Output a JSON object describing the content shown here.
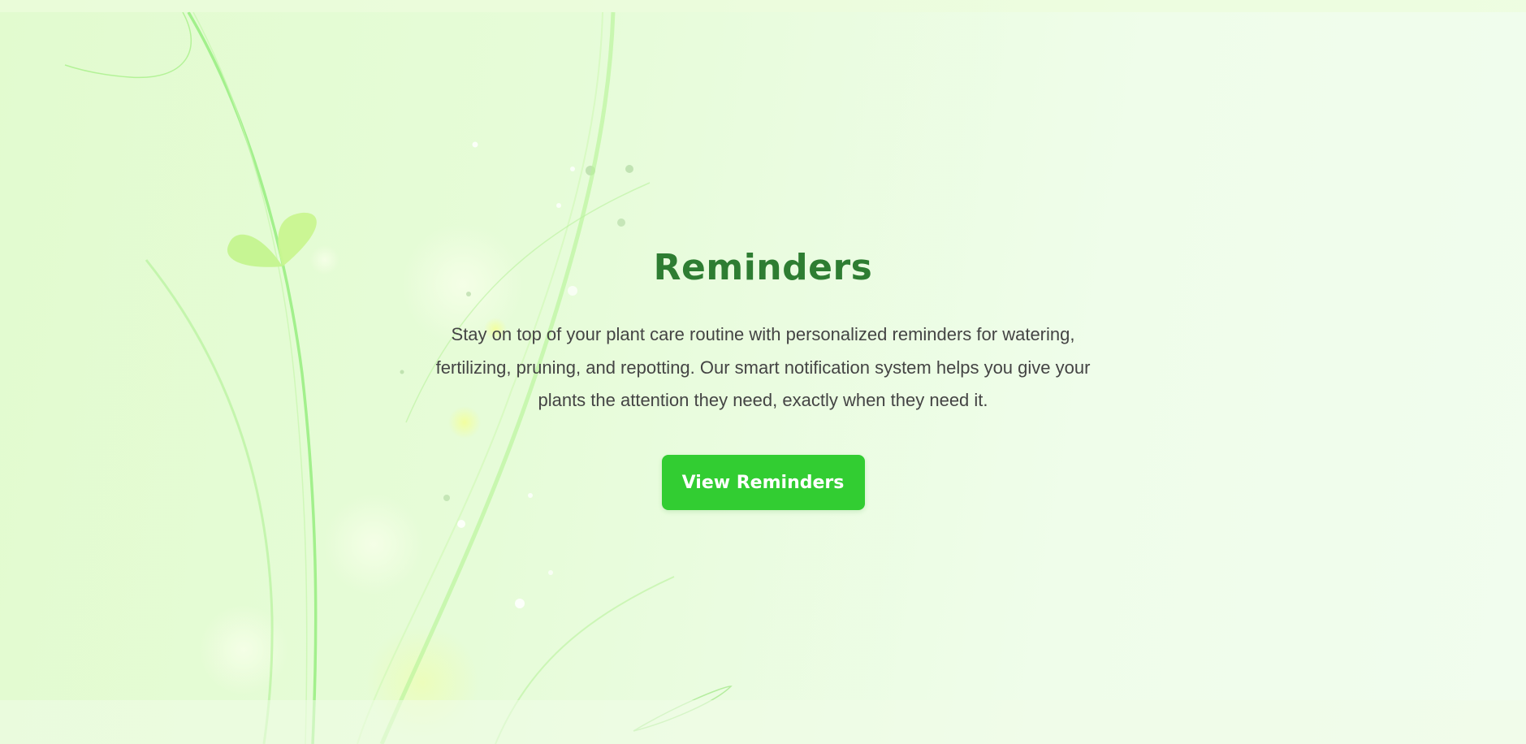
{
  "section": {
    "title": "Reminders",
    "description": "Stay on top of your plant care routine with personalized reminders for watering, fertilizing, pruning, and repotting. Our smart notification system helps you give your plants the attention they need, exactly when they need it.",
    "button_label": "View Reminders"
  },
  "colors": {
    "title": "#2e7d32",
    "text": "#444444",
    "button": "#32cd32",
    "background": "#e6fcd8"
  },
  "icons": {
    "decoration": "plant-sprout-illustration"
  }
}
